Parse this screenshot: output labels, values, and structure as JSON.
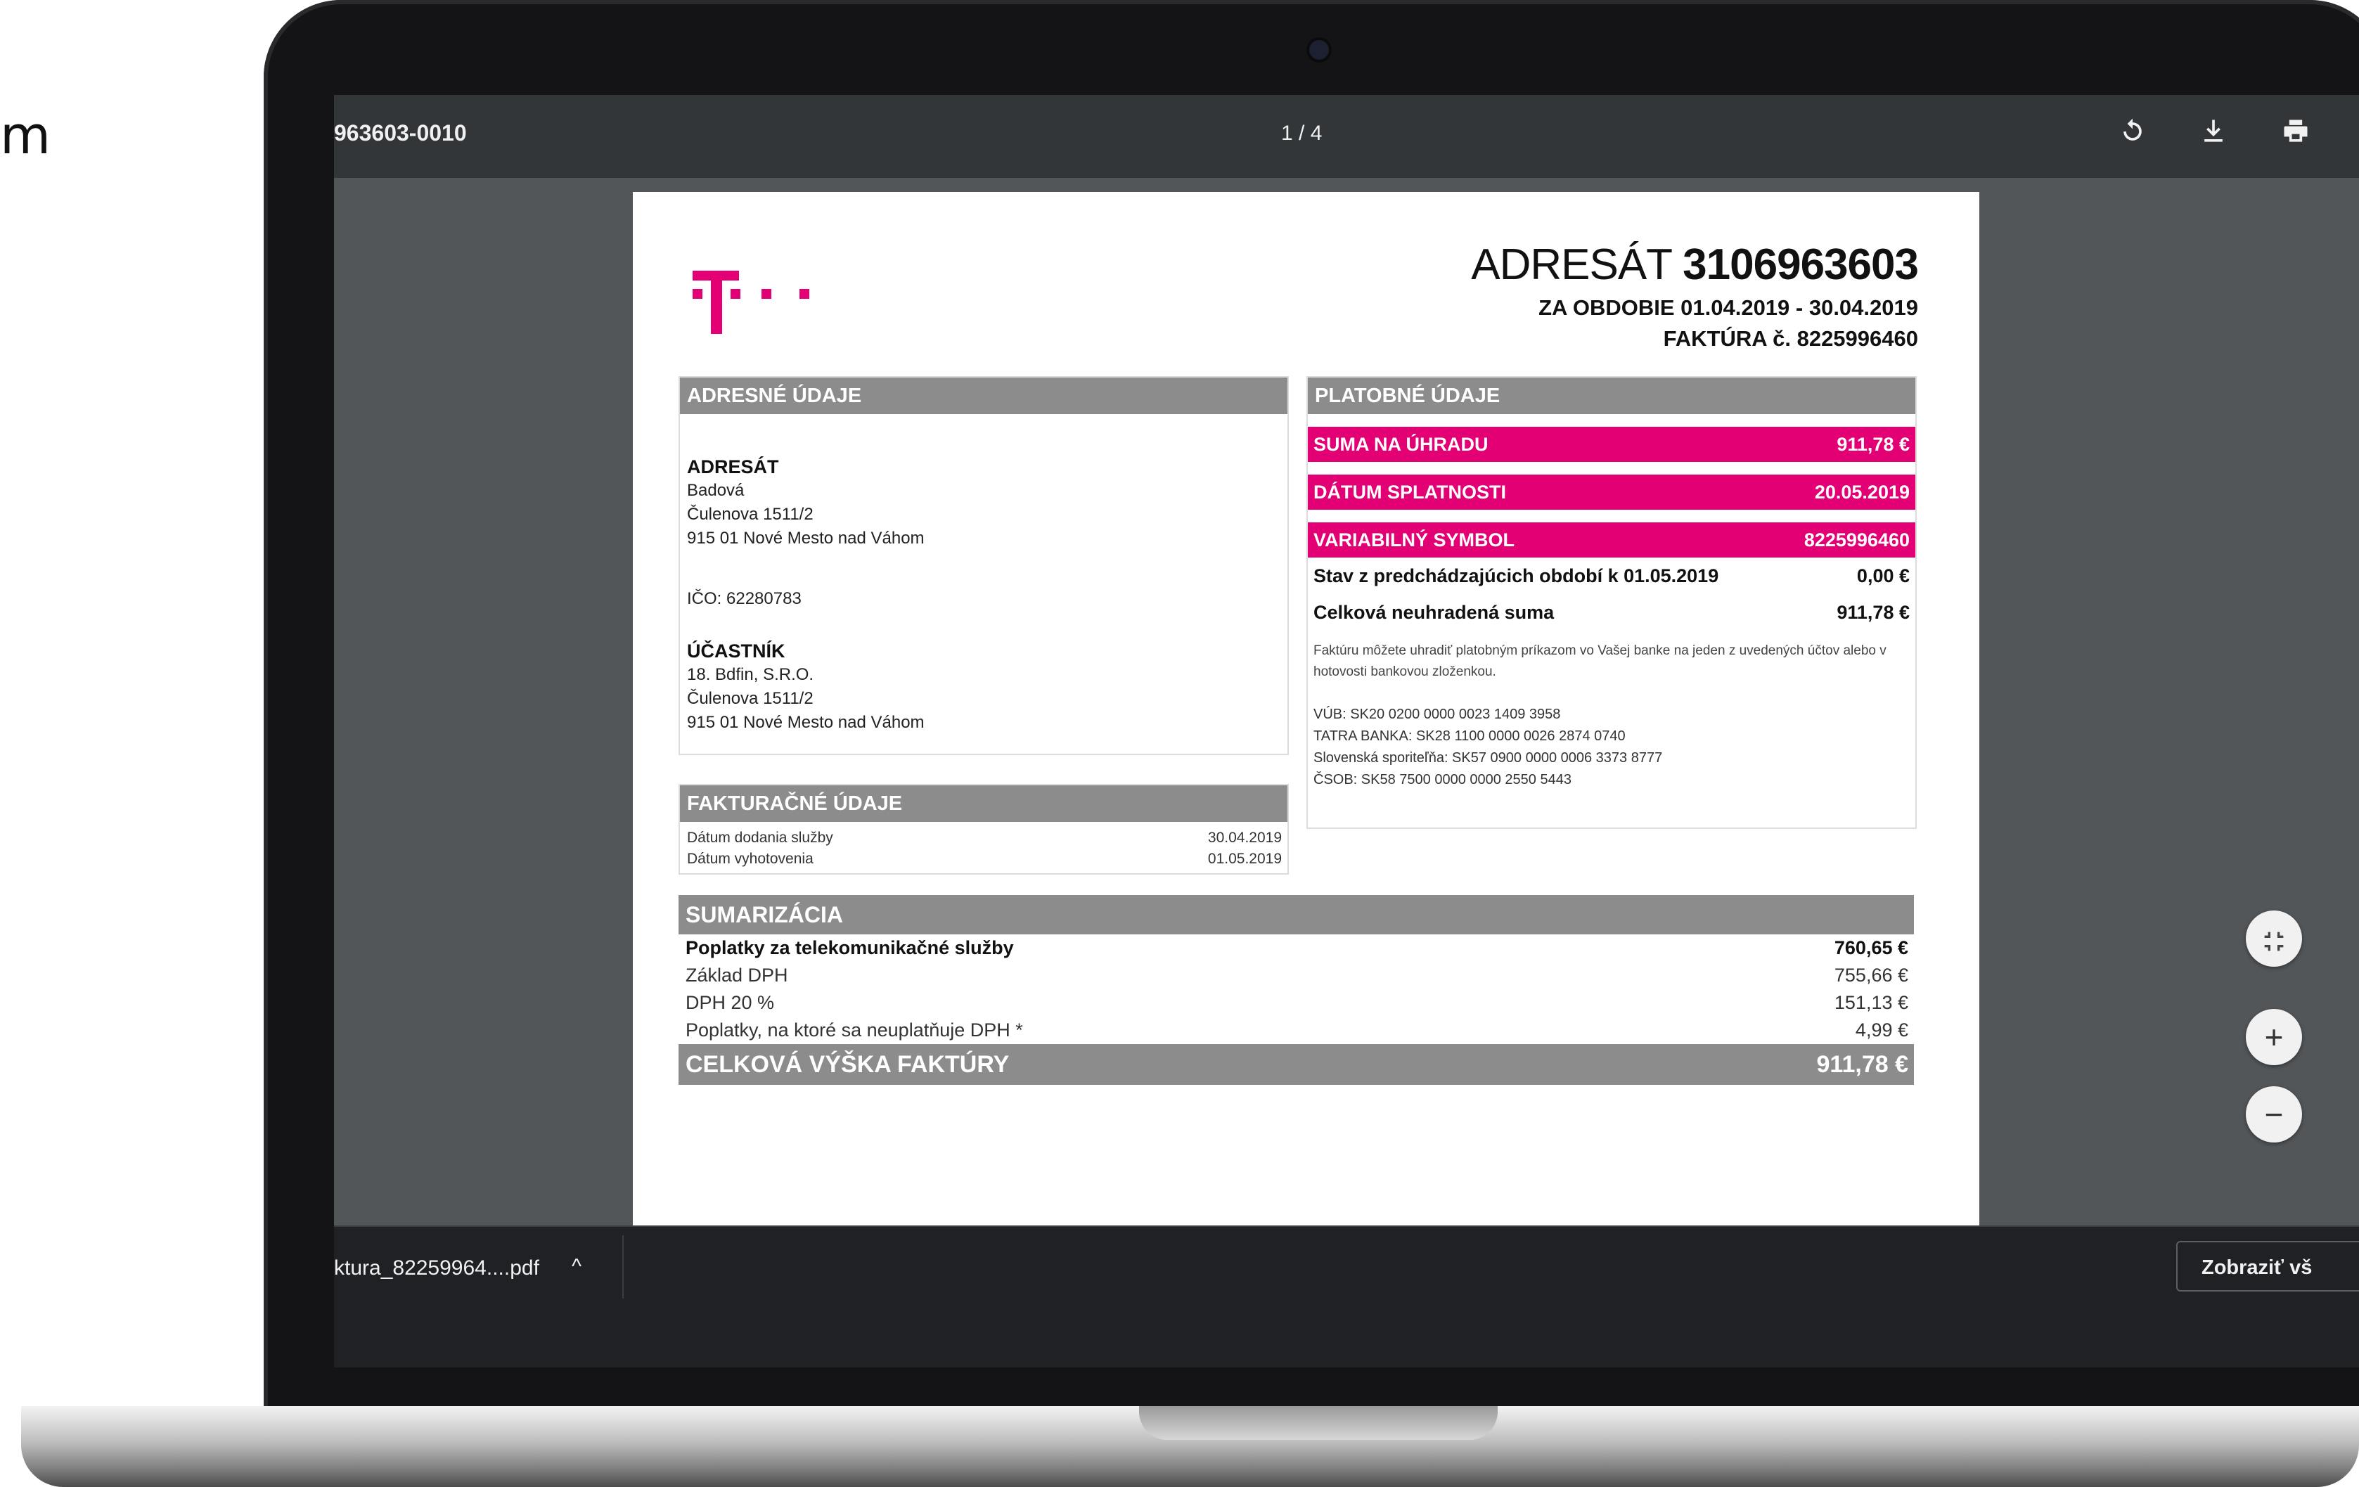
{
  "left_fragment": "m",
  "viewer": {
    "file_name": "963603-0010",
    "pager": "1 / 4",
    "icons": {
      "rotate": "rotate-icon",
      "download": "download-icon",
      "print": "print-icon"
    }
  },
  "invoice": {
    "brand_color": "#e20074",
    "header": {
      "adresat_label": "ADRESÁT",
      "adresat_number": "3106963603",
      "period": "ZA OBDOBIE 01.04.2019 - 30.04.2019",
      "invoice_no": "FAKTÚRA č. 8225996460"
    },
    "address_section": {
      "title": "ADRESNÉ ÚDAJE",
      "adresat_label": "ADRESÁT",
      "adresat_lines": [
        "Badová",
        "Čulenova 1511/2",
        "915 01 Nové Mesto nad Váhom"
      ],
      "ico": "IČO: 62280783",
      "ucastnik_label": "ÚČASTNÍK",
      "ucastnik_lines": [
        "18. Bdfin, S.R.O.",
        "Čulenova 1511/2",
        "915 01 Nové Mesto nad Váhom"
      ]
    },
    "billing_section": {
      "title": "FAKTURAČNÉ ÚDAJE",
      "rows": [
        {
          "label": "Dátum dodania služby",
          "value": "30.04.2019"
        },
        {
          "label": "Dátum vyhotovenia",
          "value": "01.05.2019"
        }
      ]
    },
    "payment_section": {
      "title": "PLATOBNÉ ÚDAJE",
      "highlight_rows": [
        {
          "label": "SUMA NA ÚHRADU",
          "value": "911,78 €"
        },
        {
          "label": "DÁTUM SPLATNOSTI",
          "value": "20.05.2019"
        },
        {
          "label": "VARIABILNÝ SYMBOL",
          "value": "8225996460"
        }
      ],
      "status_rows": [
        {
          "label": "Stav z predchádzajúcich období k 01.05.2019",
          "value": "0,00 €"
        },
        {
          "label": "Celková neuhradená suma",
          "value": "911,78 €"
        }
      ],
      "note": "Faktúru môžete uhradiť platobným príkazom vo Vašej banke na jeden z uvedených účtov alebo v hotovosti bankovou zloženkou.",
      "banks": [
        "VÚB: SK20 0200 0000 0023 1409 3958",
        "TATRA BANKA: SK28 1100 0000 0026 2874 0740",
        "Slovenská sporiteľňa: SK57 0900 0000 0006 3373 8777",
        "ČSOB: SK58 7500 0000 0000 2550 5443"
      ]
    },
    "summary": {
      "title": "SUMARIZÁCIA",
      "rows": [
        {
          "label": "Poplatky za telekomunikačné služby",
          "value": "760,65 €",
          "bold": true
        },
        {
          "label": "Základ DPH",
          "value": "755,66 €"
        },
        {
          "label": "DPH  20 %",
          "value": "151,13 €"
        },
        {
          "label": "Poplatky, na ktoré sa neuplatňuje DPH *",
          "value": "4,99 €"
        }
      ],
      "total_label": "CELKOVÁ VÝŠKA FAKTÚRY",
      "total_value": "911,78 €"
    }
  },
  "download_bar": {
    "file_name": "ktura_82259964....pdf",
    "chevron": "^",
    "show_all": "Zobraziť vš"
  },
  "zoom_controls": {
    "fit_icon": "fit-page-icon",
    "zoom_in": "+",
    "zoom_out": "−"
  }
}
